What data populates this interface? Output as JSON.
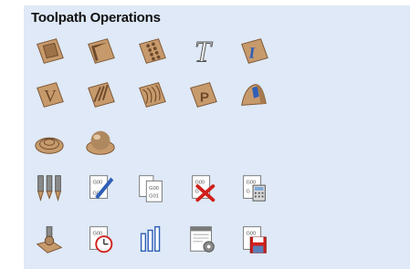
{
  "panel": {
    "title": "Toolpath Operations"
  },
  "rows": [
    [
      "2d-profile-icon",
      "pocket-icon",
      "drilling-icon",
      "quick-engrave-icon",
      "inlay-icon"
    ],
    [
      "v-carve-icon",
      "fluting-icon",
      "texture-icon",
      "prism-carve-icon",
      "moulding-icon"
    ],
    [
      "3d-roughing-icon",
      "3d-finishing-icon"
    ],
    [
      "tool-database-icon",
      "edit-post-processor-icon",
      "merge-toolpaths-icon",
      "delete-toolpaths-icon",
      "toolpath-summary-icon"
    ],
    [
      "preview-toolpaths-icon",
      "machining-time-icon",
      "toolpath-templates-icon",
      "job-setup-icon",
      "save-toolpaths-icon"
    ]
  ],
  "colors": {
    "panel_bg": "#dfe9f7",
    "wood": "#c79a6c",
    "wood_dark": "#8f6640",
    "paper": "#ffffff",
    "accent_blue": "#2f5fb7",
    "accent_red": "#d0201c"
  }
}
